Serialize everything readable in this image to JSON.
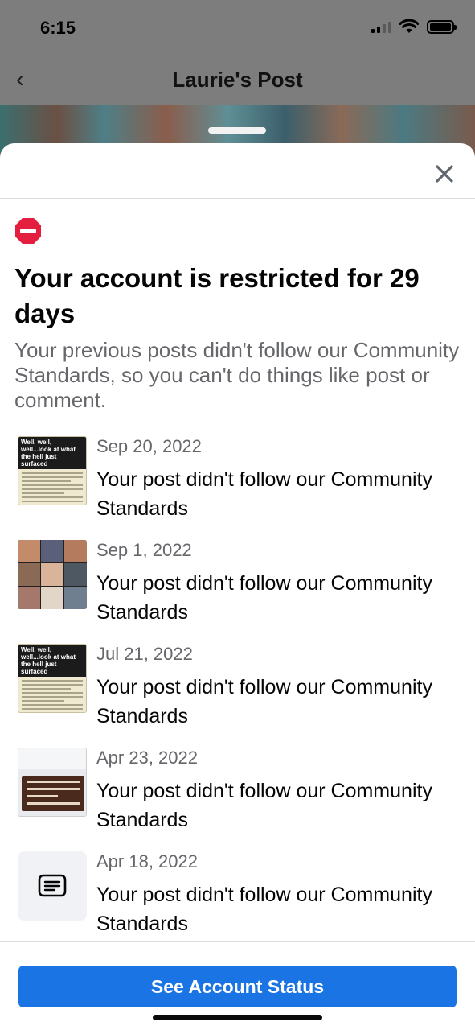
{
  "status_bar": {
    "time": "6:15"
  },
  "nav": {
    "title": "Laurie's Post"
  },
  "restriction": {
    "headline": "Your account is restricted for 29 days",
    "description": "Your previous posts didn't follow our Community Standards, so you can't do things like post or comment."
  },
  "violations": [
    {
      "date": "Sep 20, 2022",
      "message": "Your post didn't follow our Community Standards",
      "thumb_type": "document",
      "thumb_text": "Well, well, well...look at what the hell just surfaced"
    },
    {
      "date": "Sep 1, 2022",
      "message": "Your post didn't follow our Community Standards",
      "thumb_type": "collage"
    },
    {
      "date": "Jul 21, 2022",
      "message": "Your post didn't follow our Community Standards",
      "thumb_type": "document",
      "thumb_text": "Well, well, well...look at what the hell just surfaced"
    },
    {
      "date": "Apr 23, 2022",
      "message": "Your post didn't follow our Community Standards",
      "thumb_type": "screenshot"
    },
    {
      "date": "Apr 18, 2022",
      "message": "Your post didn't follow our Community Standards",
      "thumb_type": "text-post-icon"
    }
  ],
  "cta": {
    "label": "See Account Status",
    "color": "#1b74e4"
  },
  "icons": {
    "restriction": "stop-sign-icon",
    "close": "close-icon",
    "back": "chevron-left-icon",
    "text_post": "text-post-icon"
  },
  "colors": {
    "restriction_red": "#e41e3f",
    "secondary_text": "#65676b"
  }
}
